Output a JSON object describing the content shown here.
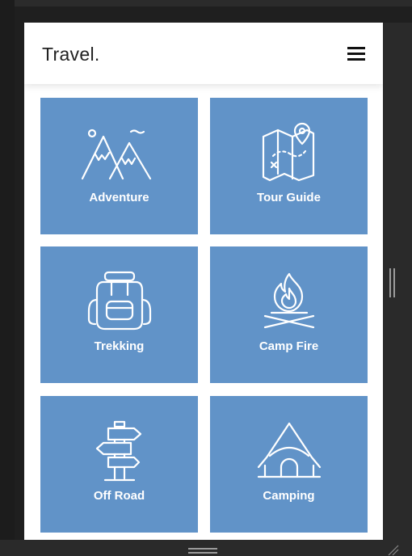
{
  "app": {
    "brand": "Travel."
  },
  "menu": {
    "icon": "hamburger-menu-icon"
  },
  "tiles": [
    {
      "label": "Adventure",
      "icon": "mountains-icon"
    },
    {
      "label": "Tour Guide",
      "icon": "map-pin-icon"
    },
    {
      "label": "Trekking",
      "icon": "backpack-icon"
    },
    {
      "label": "Camp Fire",
      "icon": "campfire-icon"
    },
    {
      "label": "Off Road",
      "icon": "signpost-icon"
    },
    {
      "label": "Camping",
      "icon": "tent-icon"
    }
  ],
  "colors": {
    "tile": "#6193c8",
    "header_bg": "#ffffff",
    "brand_text": "#222222",
    "frame": "#2a2a2a"
  }
}
